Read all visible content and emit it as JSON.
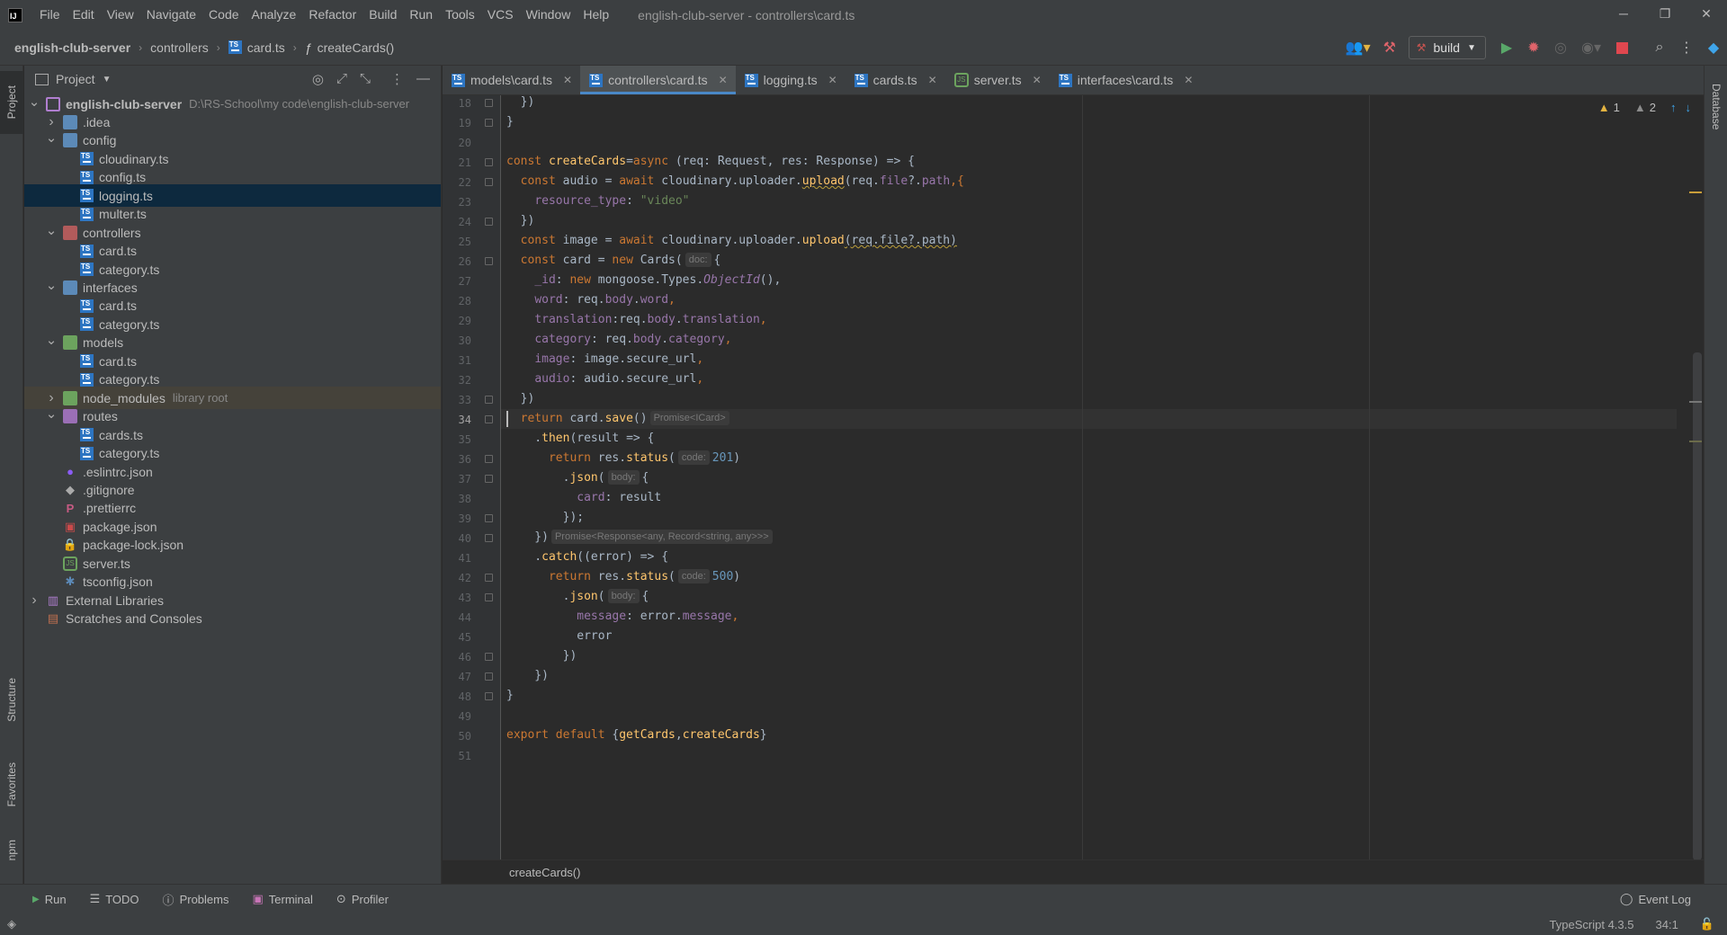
{
  "menubar": {
    "items": [
      "File",
      "Edit",
      "View",
      "Navigate",
      "Code",
      "Analyze",
      "Refactor",
      "Build",
      "Run",
      "Tools",
      "VCS",
      "Window",
      "Help"
    ],
    "window_title": "english-club-server - controllers\\card.ts"
  },
  "navbar": {
    "breadcrumbs": [
      "english-club-server",
      "controllers",
      "card.ts",
      "createCards()"
    ],
    "run_config": "build"
  },
  "side_tabs": {
    "project": "Project",
    "structure": "Structure",
    "favorites": "Favorites",
    "npm": "npm",
    "database": "Database"
  },
  "project_panel": {
    "title": "Project",
    "tree": [
      {
        "label": "english-club-server",
        "hint": "D:\\RS-School\\my code\\english-club-server",
        "type": "folder",
        "depth": 0,
        "expanded": true,
        "bold": true
      },
      {
        "label": ".idea",
        "type": "folder",
        "depth": 1,
        "expanded": false
      },
      {
        "label": "config",
        "type": "folder",
        "depth": 1,
        "expanded": true
      },
      {
        "label": "cloudinary.ts",
        "type": "ts",
        "depth": 2
      },
      {
        "label": "config.ts",
        "type": "ts",
        "depth": 2
      },
      {
        "label": "logging.ts",
        "type": "ts",
        "depth": 2,
        "selected": true
      },
      {
        "label": "multer.ts",
        "type": "ts",
        "depth": 2
      },
      {
        "label": "controllers",
        "type": "folder",
        "depth": 1,
        "expanded": true
      },
      {
        "label": "card.ts",
        "type": "ts",
        "depth": 2
      },
      {
        "label": "category.ts",
        "type": "ts",
        "depth": 2
      },
      {
        "label": "interfaces",
        "type": "folder",
        "depth": 1,
        "expanded": true
      },
      {
        "label": "card.ts",
        "type": "ts",
        "depth": 2
      },
      {
        "label": "category.ts",
        "type": "ts",
        "depth": 2
      },
      {
        "label": "models",
        "type": "folder",
        "depth": 1,
        "expanded": true
      },
      {
        "label": "card.ts",
        "type": "ts",
        "depth": 2
      },
      {
        "label": "category.ts",
        "type": "ts",
        "depth": 2
      },
      {
        "label": "node_modules",
        "hint": "library root",
        "type": "folder",
        "depth": 1,
        "expanded": false,
        "libroot": true
      },
      {
        "label": "routes",
        "type": "folder",
        "depth": 1,
        "expanded": true
      },
      {
        "label": "cards.ts",
        "type": "ts",
        "depth": 2
      },
      {
        "label": "category.ts",
        "type": "ts",
        "depth": 2
      },
      {
        "label": ".eslintrc.json",
        "type": "eslint",
        "depth": 1
      },
      {
        "label": ".gitignore",
        "type": "git",
        "depth": 1
      },
      {
        "label": ".prettierrc",
        "type": "prettier",
        "depth": 1
      },
      {
        "label": "package.json",
        "type": "npm",
        "depth": 1
      },
      {
        "label": "package-lock.json",
        "type": "lock",
        "depth": 1
      },
      {
        "label": "server.ts",
        "type": "node",
        "depth": 1
      },
      {
        "label": "tsconfig.json",
        "type": "tsconfig",
        "depth": 1
      },
      {
        "label": "External Libraries",
        "type": "lib",
        "depth": 0,
        "expanded": false
      },
      {
        "label": "Scratches and Consoles",
        "type": "scratch",
        "depth": 0
      }
    ]
  },
  "tabs": [
    {
      "label": "models\\card.ts",
      "icon": "ts",
      "active": false
    },
    {
      "label": "controllers\\card.ts",
      "icon": "ts",
      "active": true
    },
    {
      "label": "logging.ts",
      "icon": "ts",
      "active": false
    },
    {
      "label": "cards.ts",
      "icon": "ts",
      "active": false
    },
    {
      "label": "server.ts",
      "icon": "node",
      "active": false
    },
    {
      "label": "interfaces\\card.ts",
      "icon": "ts",
      "active": false
    }
  ],
  "inspections": {
    "warnings": "1",
    "weak_warnings": "2"
  },
  "editor": {
    "first_line": 18,
    "current_line": 34,
    "lines": [
      [
        {
          "t": "  })"
        }
      ],
      [
        {
          "t": "}"
        }
      ],
      [
        {
          "t": ""
        }
      ],
      [
        {
          "t": "const ",
          "c": "kw"
        },
        {
          "t": "createCards",
          "c": "fn"
        },
        {
          "t": "=",
          "c": ""
        },
        {
          "t": "async ",
          "c": "kw"
        },
        {
          "t": "(req: Request, res: Response) => {"
        }
      ],
      [
        {
          "t": "  "
        },
        {
          "t": "const ",
          "c": "kw"
        },
        {
          "t": "audio = "
        },
        {
          "t": "await ",
          "c": "kw"
        },
        {
          "t": "cloudinary.uploader."
        },
        {
          "t": "upload",
          "c": "fn u"
        },
        {
          "t": "(req."
        },
        {
          "t": "file",
          "c": "prop"
        },
        {
          "t": "?."
        },
        {
          "t": "path",
          "c": "prop"
        },
        {
          "t": ",{",
          "c": "kw"
        }
      ],
      [
        {
          "t": "    "
        },
        {
          "t": "resource_type",
          "c": "prop"
        },
        {
          "t": ": "
        },
        {
          "t": "\"video\"",
          "c": "str"
        }
      ],
      [
        {
          "t": "  })"
        }
      ],
      [
        {
          "t": "  "
        },
        {
          "t": "const ",
          "c": "kw"
        },
        {
          "t": "image = "
        },
        {
          "t": "await ",
          "c": "kw"
        },
        {
          "t": "cloudinary.uploader."
        },
        {
          "t": "upload",
          "c": "fn"
        },
        {
          "t": "(req.file?.path)",
          "c": "u"
        }
      ],
      [
        {
          "t": "  "
        },
        {
          "t": "const ",
          "c": "kw"
        },
        {
          "t": "card = "
        },
        {
          "t": "new ",
          "c": "kw"
        },
        {
          "t": "Cards("
        },
        {
          "h": "doc:"
        },
        {
          "t": "{"
        }
      ],
      [
        {
          "t": "    "
        },
        {
          "t": "_id",
          "c": "prop"
        },
        {
          "t": ": "
        },
        {
          "t": "new ",
          "c": "kw"
        },
        {
          "t": "mongoose.Types."
        },
        {
          "t": "ObjectId",
          "c": "it"
        },
        {
          "t": "(),"
        }
      ],
      [
        {
          "t": "    "
        },
        {
          "t": "word",
          "c": "prop"
        },
        {
          "t": ": req."
        },
        {
          "t": "body",
          "c": "prop"
        },
        {
          "t": "."
        },
        {
          "t": "word",
          "c": "prop"
        },
        {
          "t": ",",
          "c": "kw"
        }
      ],
      [
        {
          "t": "    "
        },
        {
          "t": "translation",
          "c": "prop"
        },
        {
          "t": ":req."
        },
        {
          "t": "body",
          "c": "prop"
        },
        {
          "t": "."
        },
        {
          "t": "translation",
          "c": "prop"
        },
        {
          "t": ",",
          "c": "kw"
        }
      ],
      [
        {
          "t": "    "
        },
        {
          "t": "category",
          "c": "prop"
        },
        {
          "t": ": req."
        },
        {
          "t": "body",
          "c": "prop"
        },
        {
          "t": "."
        },
        {
          "t": "category",
          "c": "prop"
        },
        {
          "t": ",",
          "c": "kw"
        }
      ],
      [
        {
          "t": "    "
        },
        {
          "t": "image",
          "c": "prop"
        },
        {
          "t": ": image.secure_url"
        },
        {
          "t": ",",
          "c": "kw"
        }
      ],
      [
        {
          "t": "    "
        },
        {
          "t": "audio",
          "c": "prop"
        },
        {
          "t": ": audio.secure_url"
        },
        {
          "t": ",",
          "c": "kw"
        }
      ],
      [
        {
          "t": "  })"
        }
      ],
      [
        {
          "t": "  "
        },
        {
          "t": "return ",
          "c": "kw"
        },
        {
          "t": "card."
        },
        {
          "t": "save",
          "c": "fn"
        },
        {
          "t": "()"
        },
        {
          "h": "Promise<ICard>"
        }
      ],
      [
        {
          "t": "    ."
        },
        {
          "t": "then",
          "c": "fn"
        },
        {
          "t": "(result => {"
        }
      ],
      [
        {
          "t": "      "
        },
        {
          "t": "return ",
          "c": "kw"
        },
        {
          "t": "res."
        },
        {
          "t": "status",
          "c": "fn"
        },
        {
          "t": "("
        },
        {
          "h": "code:"
        },
        {
          "t": "201",
          "c": "num"
        },
        {
          "t": ")"
        }
      ],
      [
        {
          "t": "        ."
        },
        {
          "t": "json",
          "c": "fn"
        },
        {
          "t": "("
        },
        {
          "h": "body:"
        },
        {
          "t": "{"
        }
      ],
      [
        {
          "t": "          "
        },
        {
          "t": "card",
          "c": "prop"
        },
        {
          "t": ": result"
        }
      ],
      [
        {
          "t": "        });",
          "c": ""
        }
      ],
      [
        {
          "t": "    })"
        },
        {
          "h": "Promise<Response<any, Record<string, any>>>"
        }
      ],
      [
        {
          "t": "    ."
        },
        {
          "t": "catch",
          "c": "fn"
        },
        {
          "t": "((error) => {"
        }
      ],
      [
        {
          "t": "      "
        },
        {
          "t": "return ",
          "c": "kw"
        },
        {
          "t": "res."
        },
        {
          "t": "status",
          "c": "fn"
        },
        {
          "t": "("
        },
        {
          "h": "code:"
        },
        {
          "t": "500",
          "c": "num"
        },
        {
          "t": ")"
        }
      ],
      [
        {
          "t": "        ."
        },
        {
          "t": "json",
          "c": "fn"
        },
        {
          "t": "("
        },
        {
          "h": "body:"
        },
        {
          "t": "{"
        }
      ],
      [
        {
          "t": "          "
        },
        {
          "t": "message",
          "c": "prop"
        },
        {
          "t": ": error."
        },
        {
          "t": "message",
          "c": "prop"
        },
        {
          "t": ",",
          "c": "kw"
        }
      ],
      [
        {
          "t": "          error"
        }
      ],
      [
        {
          "t": "        })"
        }
      ],
      [
        {
          "t": "    })"
        }
      ],
      [
        {
          "t": "}"
        }
      ],
      [
        {
          "t": ""
        }
      ],
      [
        {
          "t": "export default ",
          "c": "kw"
        },
        {
          "t": "{"
        },
        {
          "t": "getCards",
          "c": "fn"
        },
        {
          "t": ","
        },
        {
          "t": "createCards",
          "c": "fn"
        },
        {
          "t": "}"
        }
      ],
      [
        {
          "t": ""
        }
      ]
    ]
  },
  "editor_breadcrumb": "createCards()",
  "bottom_tools": {
    "run": "Run",
    "todo": "TODO",
    "problems": "Problems",
    "terminal": "Terminal",
    "profiler": "Profiler",
    "event_log": "Event Log"
  },
  "status": {
    "language": "TypeScript 4.3.5",
    "position": "34:1"
  },
  "colors": {
    "accent": "#4a88c7",
    "warning": "#e3b341",
    "run_green": "#59a869",
    "stop_red": "#c75450"
  }
}
